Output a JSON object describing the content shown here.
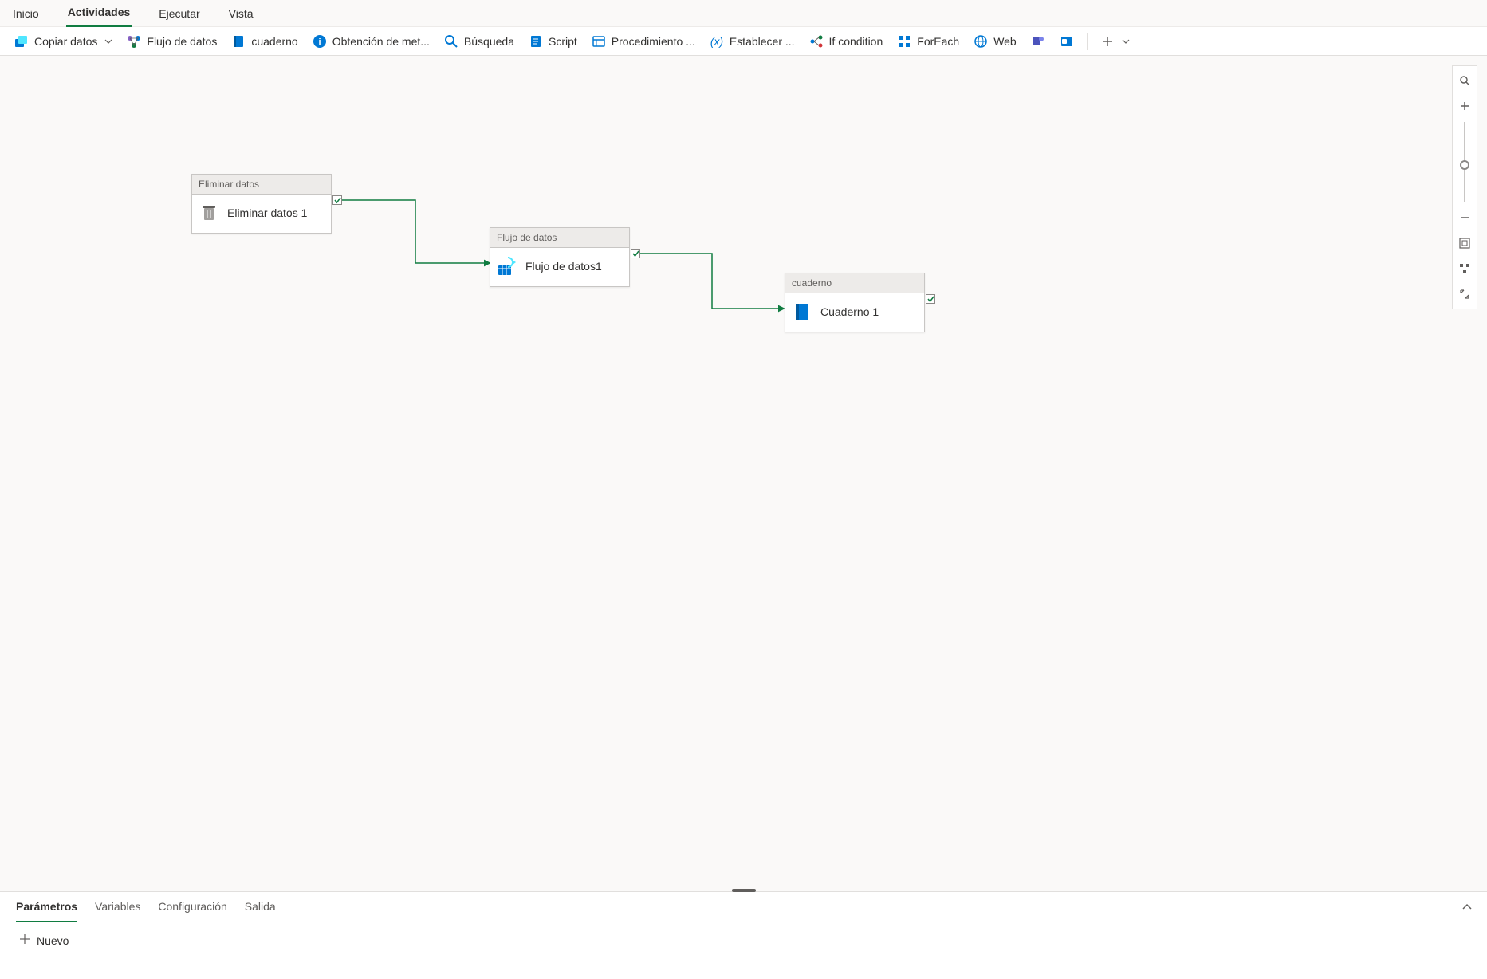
{
  "tabs": {
    "items": [
      {
        "label": "Inicio"
      },
      {
        "label": "Actividades",
        "active": true
      },
      {
        "label": "Ejecutar"
      },
      {
        "label": "Vista"
      }
    ]
  },
  "toolbar": {
    "copy": "Copiar datos",
    "dataflow": "Flujo de datos",
    "notebook": "cuaderno",
    "metadata": "Obtención de met...",
    "lookup": "Búsqueda",
    "script": "Script",
    "sproc": "Procedimiento ...",
    "setvar": "Establecer ...",
    "ifcond": "If condition",
    "foreach": "ForEach",
    "web": "Web"
  },
  "nodes": {
    "n1": {
      "type": "Eliminar datos",
      "title": "Eliminar datos 1"
    },
    "n2": {
      "type": "Flujo de datos",
      "title": "Flujo de datos1"
    },
    "n3": {
      "type": "cuaderno",
      "title": "Cuaderno 1"
    }
  },
  "panel": {
    "tabs": [
      {
        "label": "Parámetros",
        "active": true
      },
      {
        "label": "Variables"
      },
      {
        "label": "Configuración"
      },
      {
        "label": "Salida"
      }
    ],
    "new": "Nuevo"
  }
}
